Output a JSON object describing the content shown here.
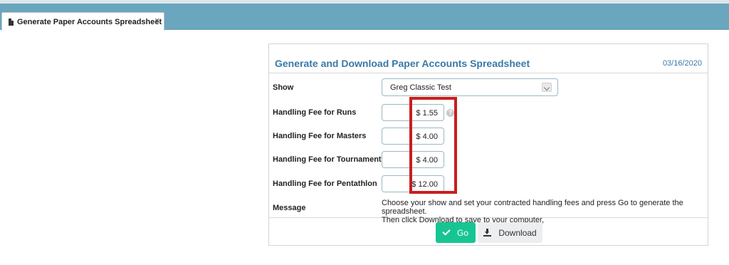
{
  "tab": {
    "label": "Generate Paper Accounts Spreadsheet",
    "icon": "document-icon",
    "close": "×"
  },
  "panel": {
    "title": "Generate and Download Paper Accounts Spreadsheet",
    "date": "03/16/2020"
  },
  "form": {
    "show_label": "Show",
    "show_value": "Greg Classic Test",
    "fees": [
      {
        "label": "Handling Fee for Runs",
        "value": "$ 1.55",
        "help": "?"
      },
      {
        "label": "Handling Fee for Masters",
        "value": "$ 4.00"
      },
      {
        "label": "Handling Fee for Tournaments",
        "value": "$ 4.00"
      },
      {
        "label": "Handling Fee for Pentathlon",
        "value": "$ 12.00"
      }
    ],
    "message_label": "Message",
    "message_line1": "Choose your show and set your contracted handling fees and press Go to generate the spreadsheet.",
    "message_line2": "Then click Download to save to your computer,"
  },
  "actions": {
    "go_label": "Go",
    "download_label": "Download"
  },
  "colors": {
    "header_band": "#6aa6bd",
    "title": "#3a79a8",
    "go_button": "#17c593",
    "highlight": "#c81e1e"
  }
}
